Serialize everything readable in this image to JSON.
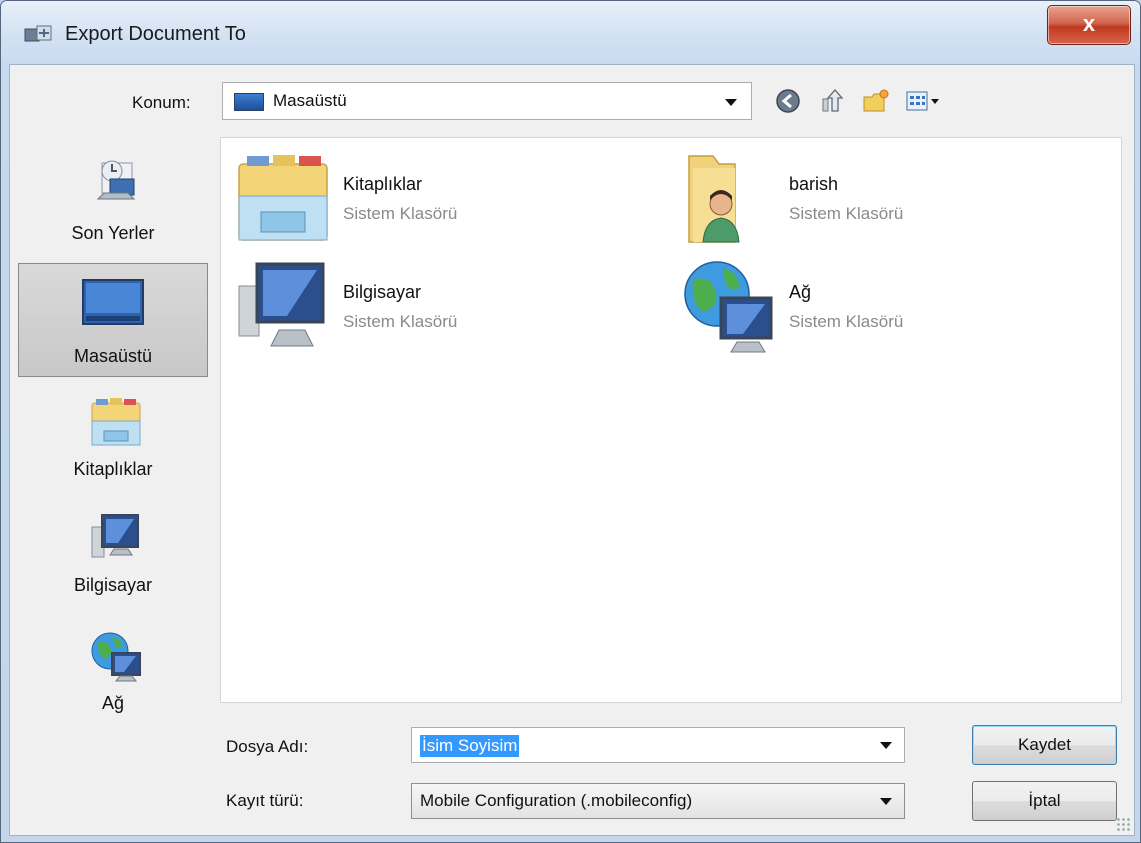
{
  "window": {
    "title": "Export Document To",
    "close_label": "x"
  },
  "location": {
    "label": "Konum:",
    "value": "Masaüstü"
  },
  "places": [
    {
      "label": "Son Yerler"
    },
    {
      "label": "Masaüstü",
      "selected": true
    },
    {
      "label": "Kitaplıklar"
    },
    {
      "label": "Bilgisayar"
    },
    {
      "label": "Ağ"
    }
  ],
  "items": [
    {
      "name": "Kitaplıklar",
      "type": "Sistem Klasörü",
      "icon": "libraries-icon"
    },
    {
      "name": "barish",
      "type": "Sistem Klasörü",
      "icon": "user-folder-icon"
    },
    {
      "name": "Bilgisayar",
      "type": "Sistem Klasörü",
      "icon": "computer-icon"
    },
    {
      "name": "Ağ",
      "type": "Sistem Klasörü",
      "icon": "network-icon"
    }
  ],
  "filename": {
    "label": "Dosya Adı:",
    "value": "İsim Soyisim"
  },
  "filetype": {
    "label": "Kayıt türü:",
    "value": "Mobile Configuration (.mobileconfig)"
  },
  "buttons": {
    "save": "Kaydet",
    "cancel": "İptal"
  },
  "colors": {
    "selection": "#3399ff",
    "close_button": "#c0391f"
  }
}
